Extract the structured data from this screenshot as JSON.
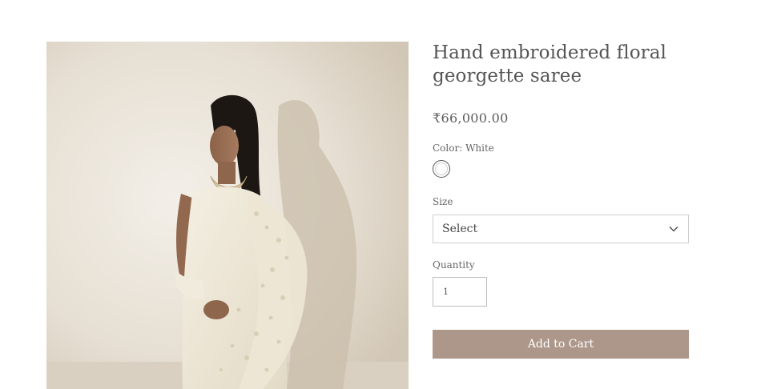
{
  "product": {
    "title_line1": "Hand embroidered floral",
    "title_line2": "georgette saree",
    "price": "₹66,000.00",
    "image_alt": "Model wearing a white hand embroidered floral georgette saree"
  },
  "options": {
    "color_label": "Color: White",
    "color_swatch": "#ffffff",
    "size_label": "Size",
    "size_selected": "Select",
    "quantity_label": "Quantity",
    "quantity_value": "1"
  },
  "actions": {
    "add_to_cart": "Add to Cart"
  },
  "colors": {
    "accent": "#ad978a",
    "text": "#555555",
    "border": "#cfcfcf"
  }
}
